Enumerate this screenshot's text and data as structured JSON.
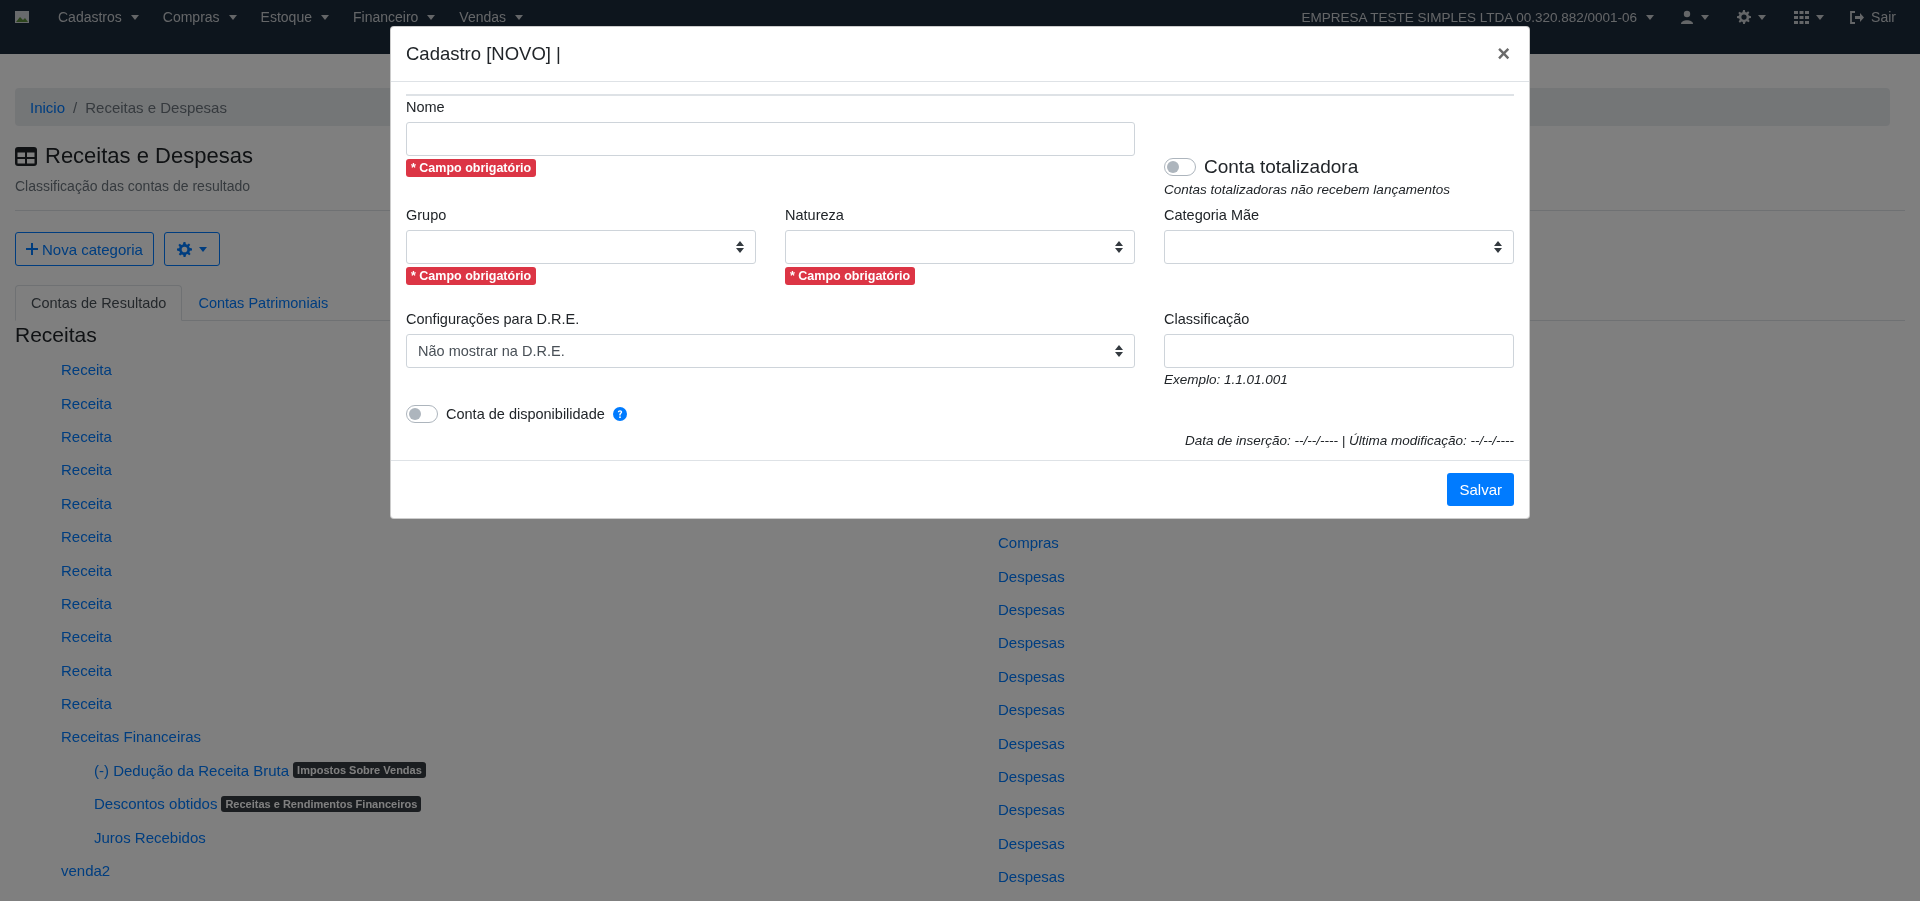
{
  "navbar": {
    "menus": [
      {
        "label": "Cadastros"
      },
      {
        "label": "Compras"
      },
      {
        "label": "Estoque"
      },
      {
        "label": "Financeiro"
      },
      {
        "label": "Vendas"
      }
    ],
    "company": "EMPRESA TESTE SIMPLES LTDA 00.320.882/0001-06",
    "logout": "Sair"
  },
  "breadcrumb": {
    "home": "Inicio",
    "separator": "/",
    "current": "Receitas e Despesas"
  },
  "page": {
    "title": "Receitas e Despesas",
    "subtitle": "Classificação das contas de resultado",
    "new_button": "Nova categoria"
  },
  "tabs": [
    {
      "label": "Contas de Resultado",
      "selected": true
    },
    {
      "label": "Contas Patrimoniais",
      "selected": false
    }
  ],
  "receitas": {
    "title": "Receitas",
    "items": [
      {
        "name": "Receita"
      },
      {
        "name": "Receita"
      },
      {
        "name": "Receita"
      },
      {
        "name": "Receita"
      },
      {
        "name": "Receita"
      },
      {
        "name": "Receita"
      },
      {
        "name": "Receita"
      },
      {
        "name": "Receita"
      },
      {
        "name": "Receita"
      },
      {
        "name": "Receita"
      },
      {
        "name": "Receita"
      },
      {
        "name": "Receitas Financeiras",
        "children": [
          {
            "name": "(-) Dedução da Receita Bruta",
            "badge": "Impostos Sobre Vendas"
          },
          {
            "name": "Descontos obtidos",
            "badge": "Receitas e Rendimentos Financeiros"
          },
          {
            "name": "Juros Recebidos"
          }
        ]
      },
      {
        "name": "venda2"
      }
    ]
  },
  "despesas": {
    "items": [
      {
        "name": "Compras"
      },
      {
        "name": "Despesas"
      },
      {
        "name": "Despesas"
      },
      {
        "name": "Despesas"
      },
      {
        "name": "Despesas"
      },
      {
        "name": "Despesas"
      },
      {
        "name": "Despesas"
      },
      {
        "name": "Despesas"
      },
      {
        "name": "Despesas"
      },
      {
        "name": "Despesas"
      },
      {
        "name": "Despesas"
      }
    ]
  },
  "modal": {
    "title": "Cadastro [NOVO] |",
    "close": "×",
    "nome": {
      "label": "Nome",
      "error": "* Campo obrigatório"
    },
    "conta_totalizadora": {
      "label": "Conta totalizadora",
      "on": false,
      "hint": "Contas totalizadoras não recebem lançamentos"
    },
    "grupo": {
      "label": "Grupo",
      "error": "* Campo obrigatório"
    },
    "natureza": {
      "label": "Natureza",
      "error": "* Campo obrigatório"
    },
    "categoria_mae": {
      "label": "Categoria Mãe"
    },
    "dre": {
      "label": "Configurações para D.R.E.",
      "value": "Não mostrar na D.R.E."
    },
    "classificacao": {
      "label": "Classificação",
      "hint": "Exemplo: 1.1.01.001"
    },
    "conta_disponibilidade": {
      "label": "Conta de disponibilidade",
      "on": false
    },
    "timestamps": "Data de inserção: --/--/---- | Última modificação: --/--/----",
    "save_button": "Salvar"
  }
}
